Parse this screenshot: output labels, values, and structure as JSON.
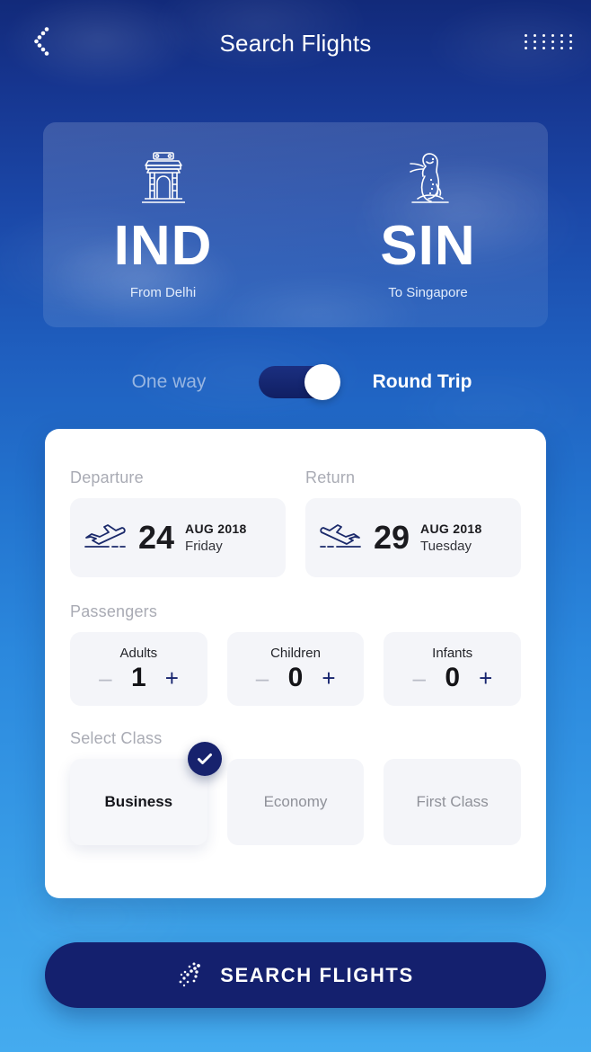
{
  "header": {
    "title": "Search Flights",
    "back_icon": "chevron-left-dotted-icon",
    "menu_icon": "dot-grid-menu-icon"
  },
  "route": {
    "from": {
      "code": "IND",
      "city_label": "From Delhi",
      "landmark_icon": "india-gate-icon"
    },
    "to": {
      "code": "SIN",
      "city_label": "To Singapore",
      "landmark_icon": "merlion-icon"
    },
    "path_icon": "dotted-plane-path-icon"
  },
  "trip_type": {
    "one_way_label": "One way",
    "round_trip_label": "Round Trip",
    "selected": "Round Trip",
    "toggle_on": true
  },
  "dates": {
    "departure": {
      "label": "Departure",
      "day": "24",
      "month_year": "AUG 2018",
      "weekday": "Friday",
      "icon": "plane-takeoff-icon"
    },
    "return": {
      "label": "Return",
      "day": "29",
      "month_year": "AUG 2018",
      "weekday": "Tuesday",
      "icon": "plane-landing-icon"
    }
  },
  "passengers": {
    "label": "Passengers",
    "items": [
      {
        "title": "Adults",
        "count": "1",
        "minus": "–",
        "plus": "+"
      },
      {
        "title": "Children",
        "count": "0",
        "minus": "–",
        "plus": "+"
      },
      {
        "title": "Infants",
        "count": "0",
        "minus": "–",
        "plus": "+"
      }
    ]
  },
  "travel_class": {
    "label": "Select Class",
    "options": [
      {
        "name": "Business",
        "selected": true
      },
      {
        "name": "Economy",
        "selected": false
      },
      {
        "name": "First Class",
        "selected": false
      }
    ],
    "selected_badge_icon": "check-circle-icon"
  },
  "search_button": {
    "label": "SEARCH FLIGHTS",
    "icon": "dotted-plane-takeoff-icon"
  },
  "colors": {
    "bg_top": "#122a7a",
    "bg_bottom": "#44abef",
    "navy": "#14206e",
    "panel": "#ffffff",
    "field_bg": "#f4f5f9",
    "muted_text": "#a9abb4",
    "inactive_label": "#98b6e2"
  }
}
